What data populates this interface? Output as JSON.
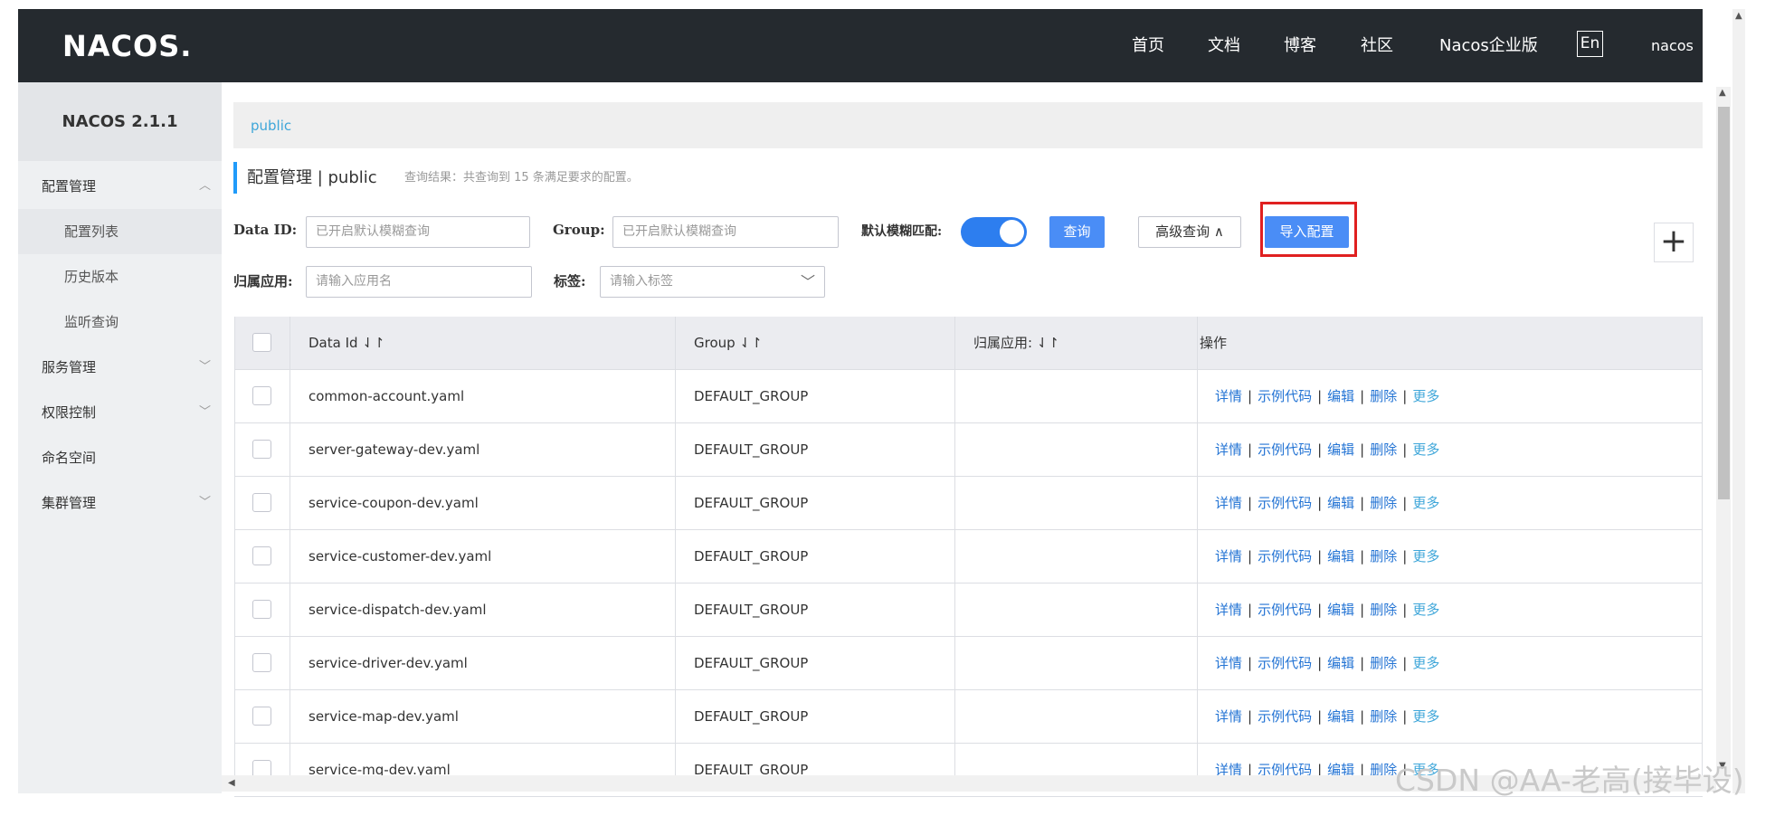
{
  "header": {
    "logo": "NACOS.",
    "nav": [
      "首页",
      "文档",
      "博客",
      "社区",
      "Nacos企业版"
    ],
    "lang": "En",
    "user": "nacos"
  },
  "sidebar": {
    "version": "NACOS 2.1.1",
    "items": [
      {
        "label": "配置管理",
        "level": "top",
        "chevron": "up"
      },
      {
        "label": "配置列表",
        "level": "sub",
        "active": true
      },
      {
        "label": "历史版本",
        "level": "sub"
      },
      {
        "label": "监听查询",
        "level": "sub"
      },
      {
        "label": "服务管理",
        "level": "top",
        "chevron": "down"
      },
      {
        "label": "权限控制",
        "level": "top",
        "chevron": "down"
      },
      {
        "label": "命名空间",
        "level": "top"
      },
      {
        "label": "集群管理",
        "level": "top",
        "chevron": "down"
      }
    ]
  },
  "breadcrumb": "public",
  "page": {
    "title": "配置管理 | public",
    "result_text": "查询结果：共查询到 15 条满足要求的配置。"
  },
  "filters": {
    "data_id_label": "Data ID:",
    "data_id_placeholder": "已开启默认模糊查询",
    "group_label": "Group:",
    "group_placeholder": "已开启默认模糊查询",
    "fuzzy_label": "默认模糊匹配:",
    "fuzzy_on": true,
    "query_button": "查询",
    "advanced_button": "高级查询 ∧",
    "import_button": "导入配置",
    "app_label": "归属应用:",
    "app_placeholder": "请输入应用名",
    "tag_label": "标签:",
    "tag_placeholder": "请输入标签"
  },
  "table": {
    "columns": [
      "Data Id ⇃↾",
      "Group ⇃↾",
      "归属应用: ⇃↾",
      "操作"
    ],
    "ops": [
      "详情",
      "示例代码",
      "编辑",
      "删除",
      "更多"
    ],
    "rows": [
      {
        "data_id": "common-account.yaml",
        "group": "DEFAULT_GROUP",
        "app": ""
      },
      {
        "data_id": "server-gateway-dev.yaml",
        "group": "DEFAULT_GROUP",
        "app": ""
      },
      {
        "data_id": "service-coupon-dev.yaml",
        "group": "DEFAULT_GROUP",
        "app": ""
      },
      {
        "data_id": "service-customer-dev.yaml",
        "group": "DEFAULT_GROUP",
        "app": ""
      },
      {
        "data_id": "service-dispatch-dev.yaml",
        "group": "DEFAULT_GROUP",
        "app": ""
      },
      {
        "data_id": "service-driver-dev.yaml",
        "group": "DEFAULT_GROUP",
        "app": ""
      },
      {
        "data_id": "service-map-dev.yaml",
        "group": "DEFAULT_GROUP",
        "app": ""
      },
      {
        "data_id": "service-mq-dev.yaml",
        "group": "DEFAULT_GROUP",
        "app": ""
      }
    ]
  },
  "watermark": "CSDN @AA-老高(接毕设)",
  "colors": {
    "header_bg": "#252a2f",
    "primary": "#4a8df6",
    "link": "#2474d4",
    "highlight": "#e02020"
  }
}
